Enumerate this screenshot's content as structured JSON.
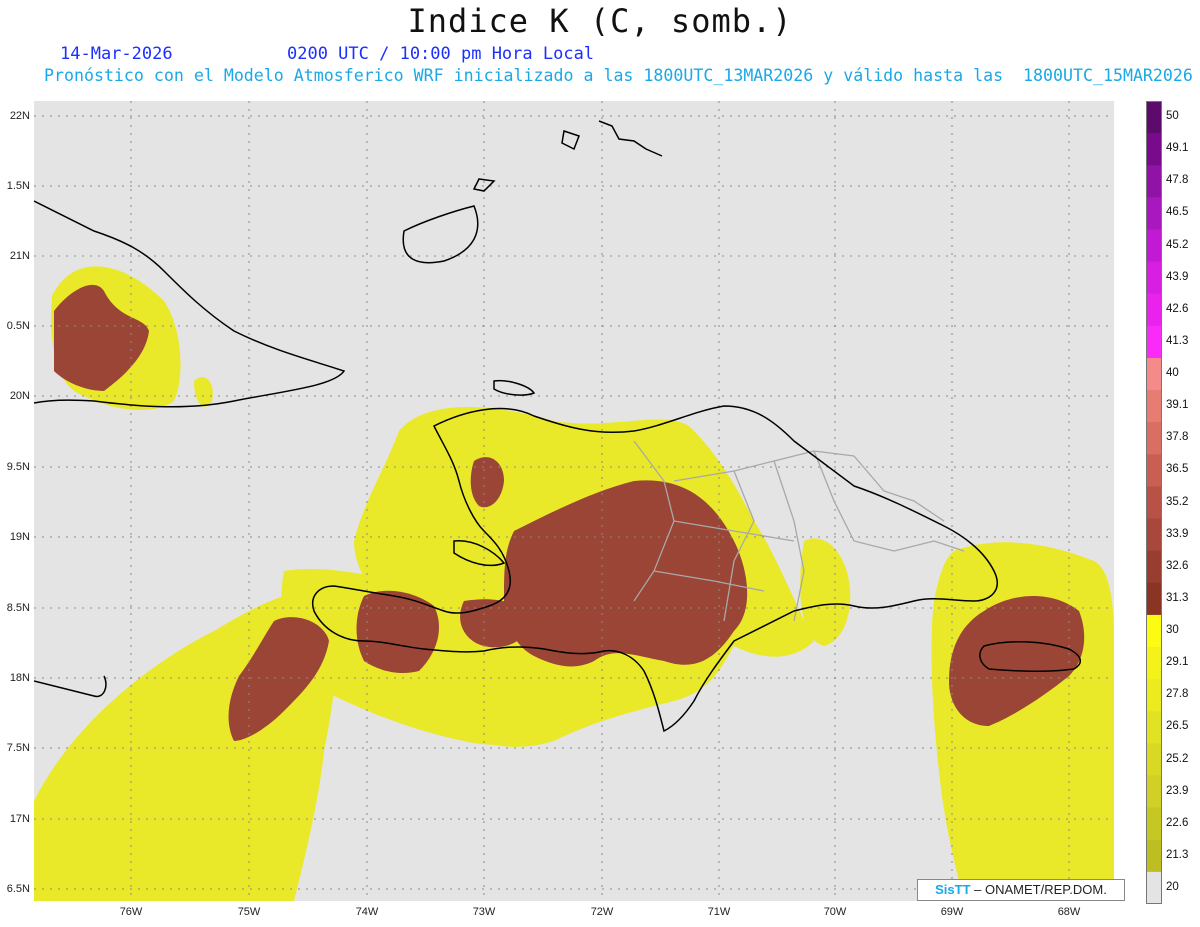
{
  "title": "Indice K (C, somb.)",
  "date_text": "14-Mar-2026",
  "time_text": "0200 UTC / 10:00 pm Hora Local",
  "description": "Pronóstico con el Modelo Atmosferico WRF inicializado a las 1800UTC_13MAR2026 y válido hasta las  1800UTC_15MAR2026",
  "latitude_labels": [
    "22N",
    "1.5N",
    "21N",
    "0.5N",
    "20N",
    "9.5N",
    "19N",
    "8.5N",
    "18N",
    "7.5N",
    "17N",
    "6.5N"
  ],
  "longitude_labels": [
    "76W",
    "75W",
    "74W",
    "73W",
    "72W",
    "71W",
    "70W",
    "69W",
    "68W"
  ],
  "legend": [
    {
      "label": "50",
      "color": "#5c0a6b"
    },
    {
      "label": "49.1",
      "color": "#7a0a8c"
    },
    {
      "label": "47.8",
      "color": "#9012a6"
    },
    {
      "label": "46.5",
      "color": "#a818be"
    },
    {
      "label": "45.2",
      "color": "#c21ad4"
    },
    {
      "label": "43.9",
      "color": "#d91ee4"
    },
    {
      "label": "42.6",
      "color": "#ea22ee"
    },
    {
      "label": "41.3",
      "color": "#fa2af8"
    },
    {
      "label": "40",
      "color": "#f48a8a"
    },
    {
      "label": "39.1",
      "color": "#e77c72"
    },
    {
      "label": "37.8",
      "color": "#d96e62"
    },
    {
      "label": "36.5",
      "color": "#c95f53"
    },
    {
      "label": "35.2",
      "color": "#b95246"
    },
    {
      "label": "33.9",
      "color": "#a8473b"
    },
    {
      "label": "32.6",
      "color": "#983d30"
    },
    {
      "label": "31.3",
      "color": "#8a3524"
    },
    {
      "label": "30",
      "color": "#fbfb14"
    },
    {
      "label": "29.1",
      "color": "#f3f31b"
    },
    {
      "label": "27.8",
      "color": "#ebeb20"
    },
    {
      "label": "26.5",
      "color": "#e2e224"
    },
    {
      "label": "25.2",
      "color": "#d9d925"
    },
    {
      "label": "23.9",
      "color": "#d0d026"
    },
    {
      "label": "22.6",
      "color": "#c7c724"
    },
    {
      "label": "21.3",
      "color": "#bebe22"
    },
    {
      "label": "20",
      "color": "#e4e4e4"
    }
  ],
  "colors": {
    "map_background": "#e4e4e4",
    "yellow_field": "#e9e92a",
    "brown_field": "#9a4535",
    "coastline": "#000000",
    "borders": "#a8a8a8"
  },
  "credit": {
    "brand": "SisTT",
    "text": "– ONAMET/REP.DOM."
  }
}
